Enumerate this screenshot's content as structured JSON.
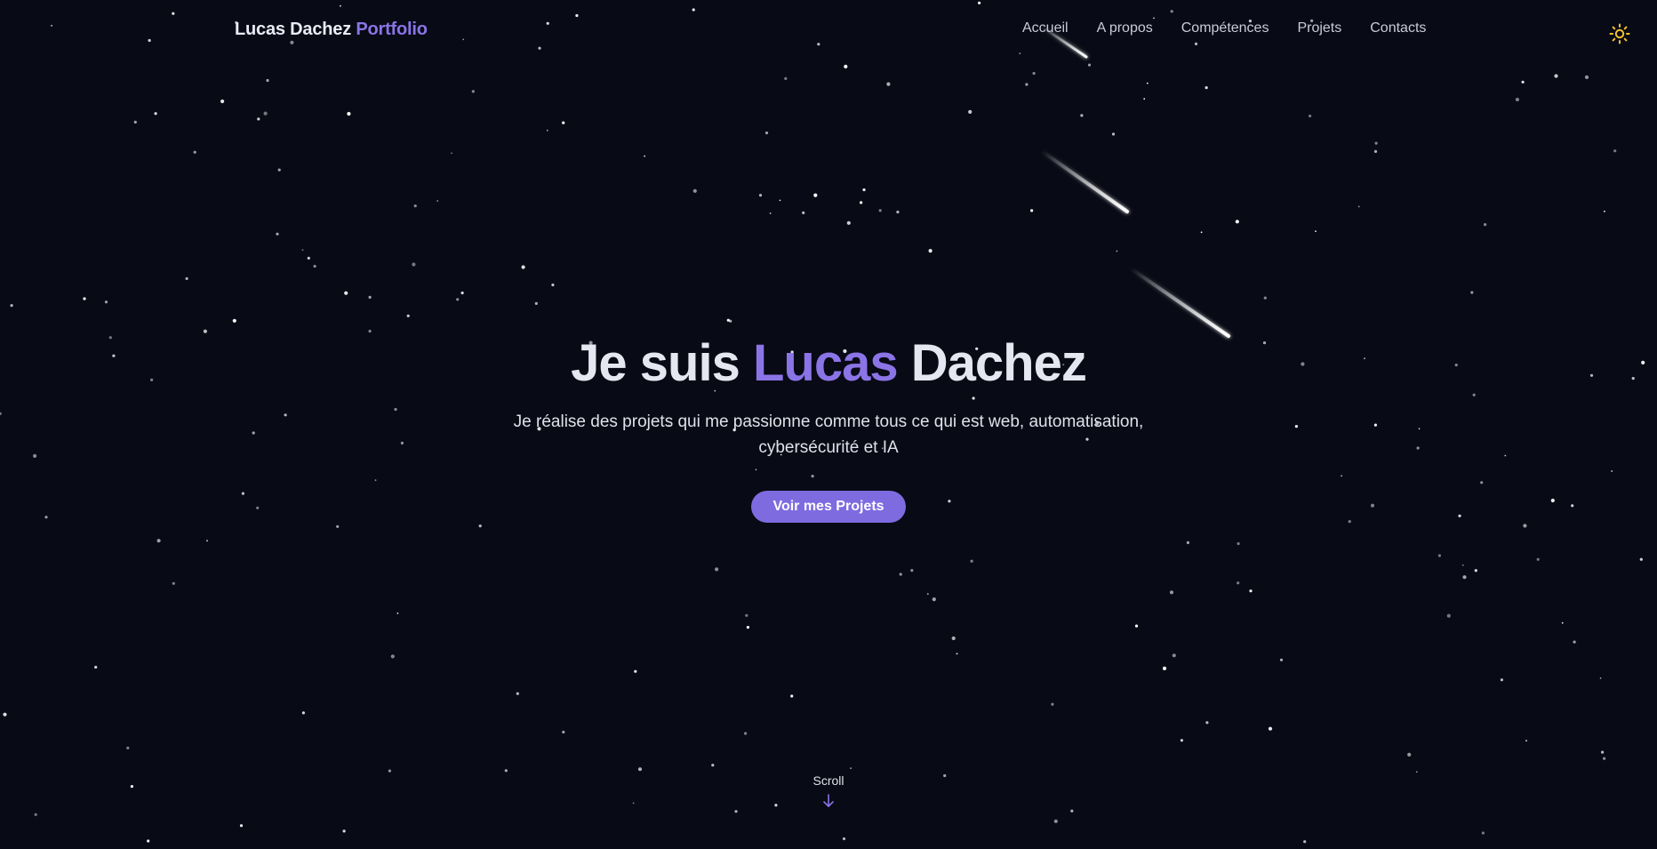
{
  "header": {
    "logo_name": "Lucas Dachez",
    "logo_accent": "Portfolio",
    "nav": [
      {
        "label": "Accueil"
      },
      {
        "label": "A propos"
      },
      {
        "label": "Compétences"
      },
      {
        "label": "Projets"
      },
      {
        "label": "Contacts"
      }
    ],
    "theme_icon": "sun-icon"
  },
  "hero": {
    "title_prefix": "Je suis ",
    "title_accent": "Lucas",
    "title_suffix": " Dachez",
    "subtitle": "Je réalise des projets qui me passionne comme tous ce qui est web, automatisation, cybersécurité et IA",
    "cta_label": "Voir mes Projets"
  },
  "scroll": {
    "label": "Scroll",
    "icon": "arrow-down-icon"
  },
  "colors": {
    "background": "#080a15",
    "accent": "#8b74e6",
    "button": "#7e6be0",
    "sun": "#f4c430"
  }
}
